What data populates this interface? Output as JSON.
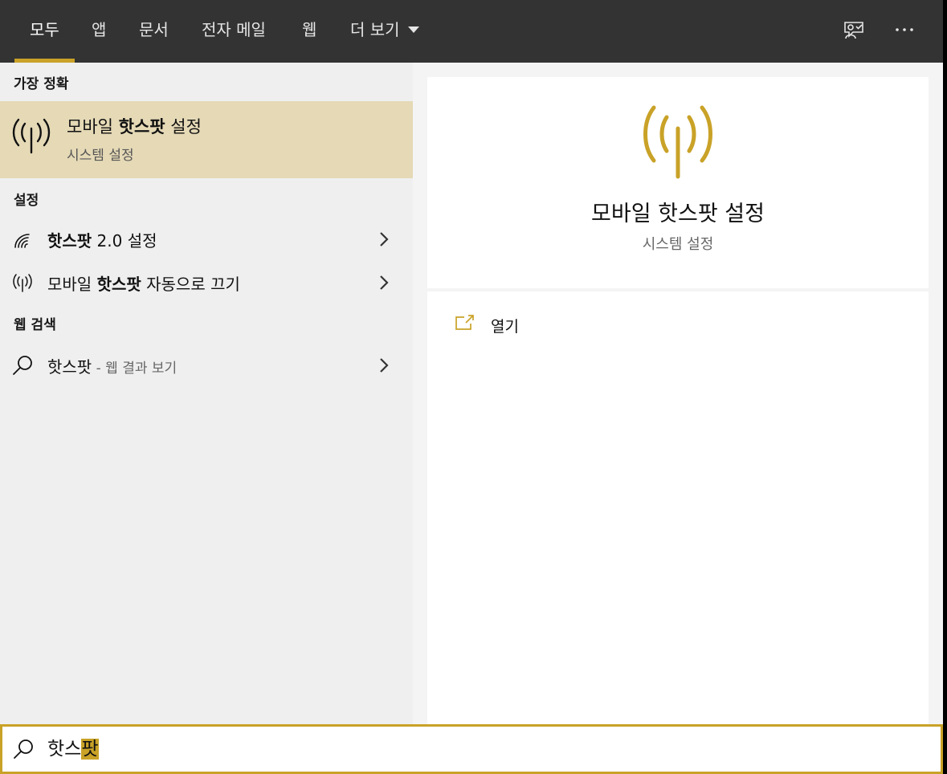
{
  "tabs": [
    {
      "label": "모두",
      "active": true
    },
    {
      "label": "앱"
    },
    {
      "label": "문서"
    },
    {
      "label": "전자 메일"
    },
    {
      "label": "웹"
    },
    {
      "label": "더 보기"
    }
  ],
  "top_icons": [
    "feedback-icon",
    "more-options-icon"
  ],
  "best_match": {
    "header": "가장 정확",
    "title_pre": "모바일 ",
    "title_bold": "핫스팟",
    "title_post": " 설정",
    "subtitle": "시스템 설정",
    "icon": "hotspot-antenna-icon"
  },
  "settings": {
    "header": "설정",
    "items": [
      {
        "bold": "핫스팟",
        "rest": " 2.0 설정",
        "icon": "wifi-hotspot-icon"
      },
      {
        "pre": "모바일 ",
        "bold": "핫스팟",
        "rest": " 자동으로 끄기",
        "icon": "hotspot-antenna-icon"
      }
    ]
  },
  "web_search": {
    "header": "웹 검색",
    "query": "핫스팟",
    "suffix": " - 웹 결과 보기"
  },
  "preview": {
    "title": "모바일 핫스팟 설정",
    "subtitle": "시스템 설정",
    "open_label": "열기"
  },
  "search": {
    "value_plain": "핫스",
    "value_highlight": "팟"
  },
  "colors": {
    "accent": "#c9a227",
    "topbar": "#333333",
    "selected_row": "#e5d9b6"
  }
}
